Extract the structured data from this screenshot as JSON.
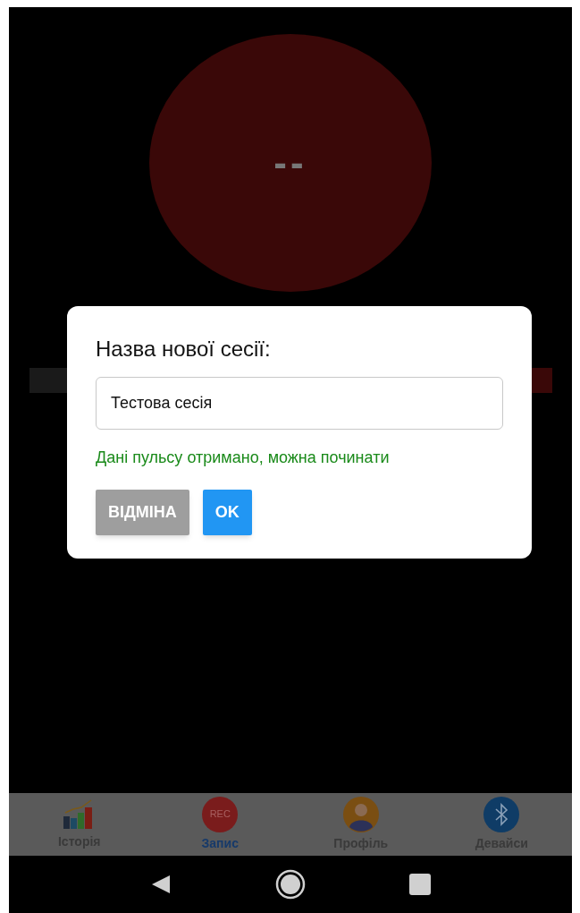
{
  "pulse": {
    "reading": "--"
  },
  "progress": {
    "level": 0.93
  },
  "dialog": {
    "title": "Назва нової сесії:",
    "input": {
      "value": "Тестова сесія"
    },
    "status": "Дані пульсу отримано, можна починати",
    "buttons": [
      {
        "label": "ВІДМІНА",
        "kind": "cancel"
      },
      {
        "label": "OK",
        "kind": "confirm"
      }
    ]
  },
  "tabs": [
    {
      "label": "Історія",
      "kind": "chart",
      "selected": false
    },
    {
      "label": "Запис",
      "kind": "rec",
      "selected": true,
      "badge": "REC"
    },
    {
      "label": "Профіль",
      "kind": "profile",
      "selected": false
    },
    {
      "label": "Девайси",
      "kind": "bluetooth",
      "selected": false
    }
  ]
}
